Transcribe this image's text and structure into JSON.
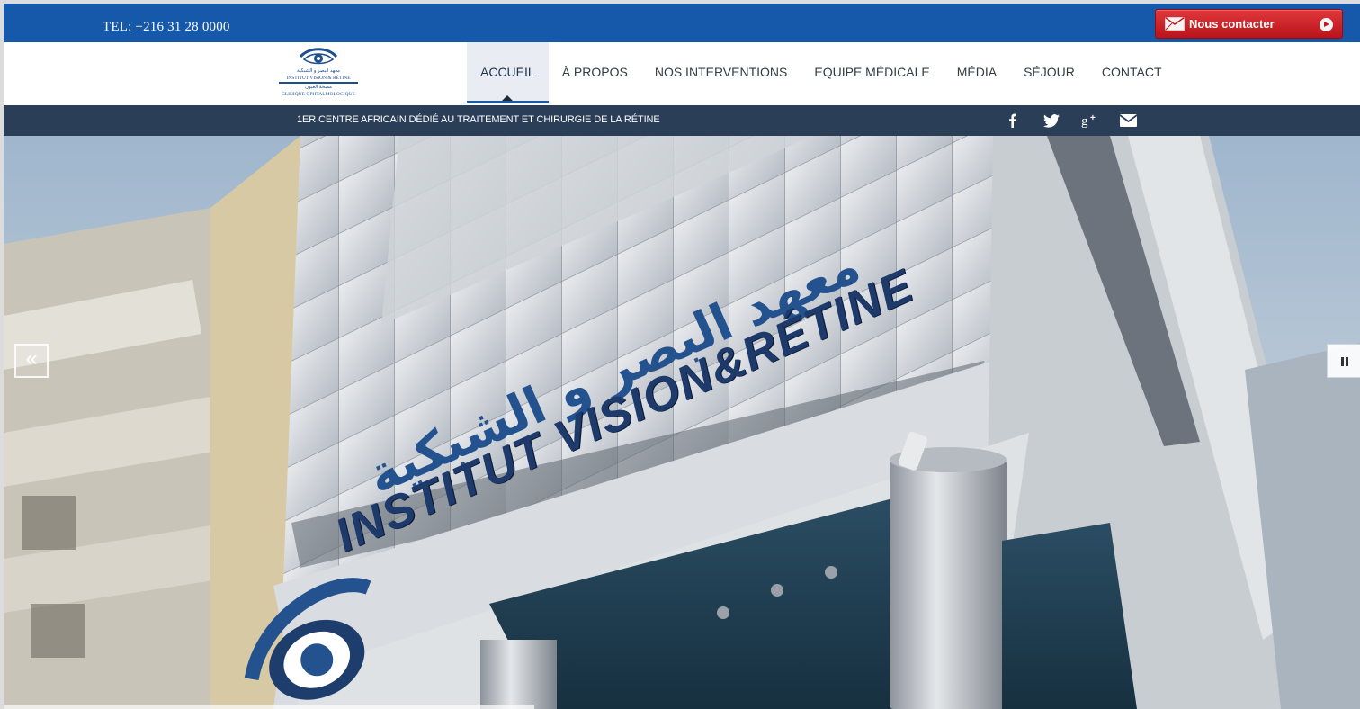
{
  "topbar": {
    "tel": "TEL: +216 31 28 0000",
    "contact_button": {
      "label": "Nous contacter",
      "icon": "envelope-icon",
      "arrow_icon": "play-icon"
    },
    "background_color": "#1659ab",
    "button_color": "#c3171d"
  },
  "logo": {
    "arabic_top": "معهد البصر و الشبكية",
    "name": "INSTITUT VISION & RÉTINE",
    "arabic_sub": "مصحة العيون",
    "sub": "CLINIQUE OPHTALMOLOGIQUE"
  },
  "nav": {
    "items": [
      {
        "label": "ACCUEIL",
        "active": true
      },
      {
        "label": "À PROPOS",
        "active": false
      },
      {
        "label": "NOS INTERVENTIONS",
        "active": false
      },
      {
        "label": "EQUIPE MÉDICALE",
        "active": false
      },
      {
        "label": "MÉDIA",
        "active": false
      },
      {
        "label": "SÉJOUR",
        "active": false
      },
      {
        "label": "CONTACT",
        "active": false
      }
    ],
    "accent_color": "#1e5aa8"
  },
  "strip": {
    "tagline": "1ER CENTRE AFRICAIN DÉDIÉ AU TRAITEMENT ET CHIRURGIE DE LA RÉTINE",
    "social": [
      "facebook-icon",
      "twitter-icon",
      "google-plus-icon",
      "envelope-icon"
    ],
    "background_color": "#2b3e58"
  },
  "hero": {
    "sign_french": "INSTITUT VISION&RÉTINE",
    "sign_arabic": "معهد البصر و الشبكية",
    "prev_icon": "double-chevron-left-icon",
    "pause_icon": "pause-icon"
  }
}
